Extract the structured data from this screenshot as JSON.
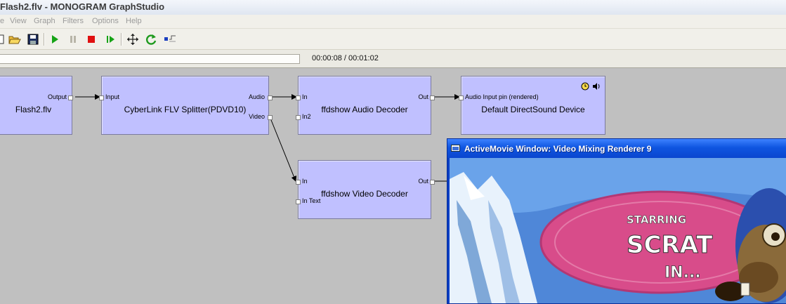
{
  "window": {
    "title": "Flash2.flv - MONOGRAM GraphStudio"
  },
  "menu": [
    "e",
    "View",
    "Graph",
    "Filters",
    "Options",
    "Help"
  ],
  "toolbar_icons": [
    "new-icon",
    "open-folder-icon",
    "save-icon",
    "play-icon",
    "pause-icon",
    "stop-icon",
    "frame-step-icon",
    "arrange-icon",
    "refresh-icon",
    "seek-icon"
  ],
  "playback": {
    "time": "00:00:08 / 00:01:02"
  },
  "graph": {
    "filters": [
      {
        "id": "source",
        "name": "Flash2.flv",
        "pins_in": [],
        "pins_out": [
          "Output"
        ]
      },
      {
        "id": "splitter",
        "name": "CyberLink FLV Splitter(PDVD10)",
        "pins_in": [
          "Input"
        ],
        "pins_out": [
          "Audio",
          "Video"
        ]
      },
      {
        "id": "audio_dec",
        "name": "ffdshow Audio Decoder",
        "pins_in": [
          "In",
          "In2"
        ],
        "pins_out": [
          "Out"
        ]
      },
      {
        "id": "renderer",
        "name": "Default DirectSound Device",
        "pins_in": [
          "Audio Input pin (rendered)"
        ],
        "pins_out": []
      },
      {
        "id": "video_dec",
        "name": "ffdshow Video Decoder",
        "pins_in": [
          "In",
          "In Text"
        ],
        "pins_out": [
          "Out"
        ]
      }
    ]
  },
  "video_window": {
    "title": "ActiveMovie Window: Video Mixing Renderer 9",
    "content": {
      "line1": "STARRING",
      "line2": "SCRAT",
      "line3": "IN..."
    }
  }
}
